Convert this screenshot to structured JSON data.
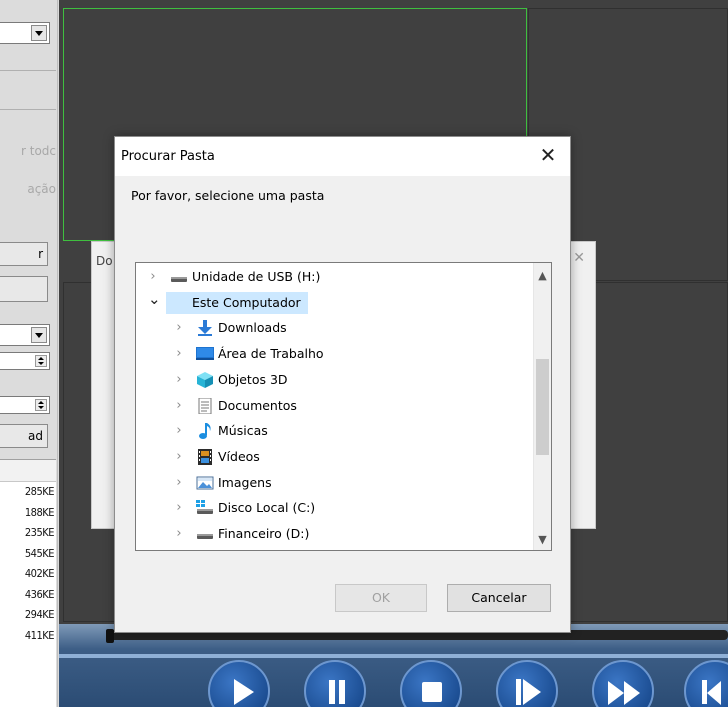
{
  "left_panel": {
    "grey_text_1": "r todc",
    "grey_text_2": "ação",
    "button_1_label": "r",
    "button_2_label": "",
    "download_label": "ad",
    "file_sizes": [
      "285KE",
      "188KE",
      "235KE",
      "545KE",
      "402KE",
      "436KE",
      "294KE",
      "411KE"
    ]
  },
  "background_dialog": {
    "title_fragment": "Do",
    "close_glyph": "✕"
  },
  "dialog": {
    "title": "Procurar Pasta",
    "close_glyph": "✕",
    "prompt": "Por favor, selecione uma pasta",
    "ok_label": "OK",
    "cancel_label": "Cancelar",
    "tree": [
      {
        "label": "Unidade de USB (H:)",
        "icon": "usb-drive-icon",
        "expanded": false,
        "level": 0
      },
      {
        "label": "Este Computador",
        "icon": "computer-icon",
        "expanded": true,
        "level": 0,
        "selected": true
      },
      {
        "label": "Downloads",
        "icon": "downloads-icon",
        "expanded": false,
        "level": 1
      },
      {
        "label": "Área de Trabalho",
        "icon": "desktop-icon",
        "expanded": false,
        "level": 1
      },
      {
        "label": "Objetos 3D",
        "icon": "objects-3d-icon",
        "expanded": false,
        "level": 1
      },
      {
        "label": "Documentos",
        "icon": "documents-icon",
        "expanded": false,
        "level": 1
      },
      {
        "label": "Músicas",
        "icon": "music-icon",
        "expanded": false,
        "level": 1
      },
      {
        "label": "Vídeos",
        "icon": "videos-icon",
        "expanded": false,
        "level": 1
      },
      {
        "label": "Imagens",
        "icon": "pictures-icon",
        "expanded": false,
        "level": 1
      },
      {
        "label": "Disco Local (C:)",
        "icon": "local-disk-icon",
        "expanded": false,
        "level": 1
      },
      {
        "label": "Financeiro (D:)",
        "icon": "drive-icon",
        "expanded": false,
        "level": 1
      }
    ]
  },
  "playback": {
    "buttons": [
      "play",
      "pause",
      "stop",
      "step-forward",
      "fast-forward",
      "skip-back"
    ]
  },
  "colors": {
    "video_bg": "#404040",
    "selected_cell_border": "#3fbf3f",
    "selection_highlight": "#cce8ff",
    "playbar_blue": "#2b4c74"
  }
}
